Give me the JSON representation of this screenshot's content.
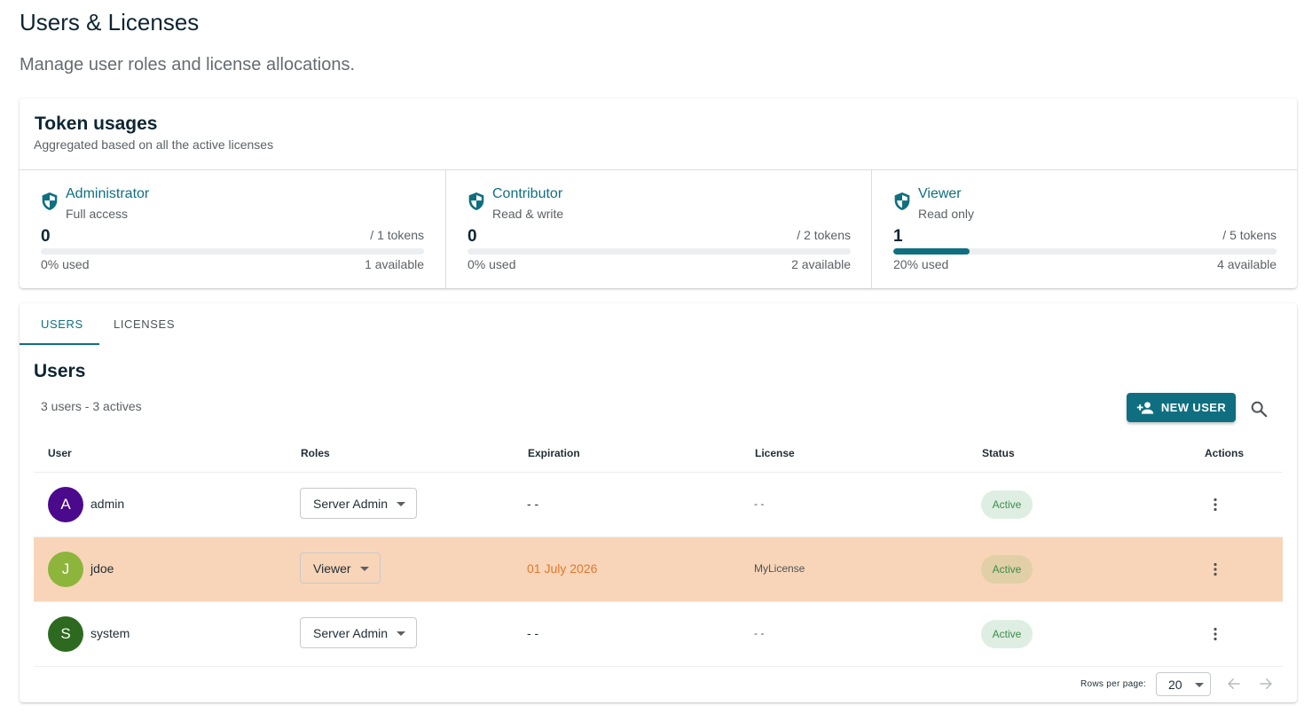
{
  "header": {
    "title": "Users & Licenses",
    "subtitle": "Manage user roles and license allocations."
  },
  "token_usages": {
    "title": "Token usages",
    "subtitle": "Aggregated based on all the active licenses",
    "roles": [
      {
        "name": "Administrator",
        "description": "Full access",
        "count": "0",
        "total": "/ 1 tokens",
        "used_label": "0% used",
        "available": "1 available",
        "used_fraction": 0
      },
      {
        "name": "Contributor",
        "description": "Read & write",
        "count": "0",
        "total": "/ 2 tokens",
        "used_label": "0% used",
        "available": "2 available",
        "used_fraction": 0
      },
      {
        "name": "Viewer",
        "description": "Read only",
        "count": "1",
        "total": "/ 5 tokens",
        "used_label": "20% used",
        "available": "4 available",
        "used_fraction": 0.2
      }
    ],
    "icon": "shield-icon"
  },
  "tabs": [
    {
      "label": "USERS",
      "active": true
    },
    {
      "label": "LICENSES",
      "active": false
    }
  ],
  "users_section": {
    "title": "Users",
    "count_text": "3 users - 3 actives",
    "new_user_label": "NEW USER",
    "new_user_icon": "person-add-icon",
    "search_icon": "search-icon"
  },
  "table": {
    "columns": [
      "User",
      "Roles",
      "Expiration",
      "License",
      "Status",
      "Actions"
    ],
    "rows": [
      {
        "initial": "A",
        "avatar_color": "#4b0a8c",
        "username": "admin",
        "role": "Server Admin",
        "expiration": "- -",
        "license": "- -",
        "status": "Active",
        "highlight": false
      },
      {
        "initial": "J",
        "avatar_color": "#8db53c",
        "username": "jdoe",
        "role": "Viewer",
        "expiration": "01 July 2026",
        "license": "MyLicense",
        "status": "Active",
        "highlight": true
      },
      {
        "initial": "S",
        "avatar_color": "#2d6a1f",
        "username": "system",
        "role": "Server Admin",
        "expiration": "- -",
        "license": "- -",
        "status": "Active",
        "highlight": false
      }
    ]
  },
  "pagination": {
    "rows_per_page_label": "Rows per page:",
    "rows_per_page_value": "20"
  },
  "colors": {
    "accent": "#0f6f80",
    "highlight_row": "#f8d5b8",
    "warning_text": "#e0782c",
    "status_chip_bg": "#dfeee2"
  }
}
